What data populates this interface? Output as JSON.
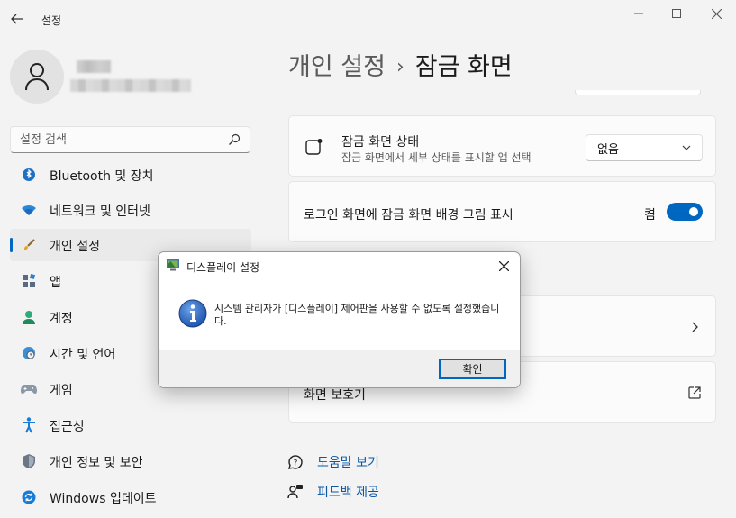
{
  "window": {
    "title": "설정",
    "back_icon": "arrow-left-icon",
    "minimize_icon": "minimize-icon",
    "maximize_icon": "maximize-icon",
    "close_icon": "close-icon"
  },
  "search": {
    "placeholder": "설정 검색",
    "icon": "search-icon"
  },
  "sidebar": {
    "items": [
      {
        "label": "Bluetooth 및 장치",
        "icon": "bluetooth-icon",
        "active": false
      },
      {
        "label": "네트워크 및 인터넷",
        "icon": "wifi-icon",
        "active": false
      },
      {
        "label": "개인 설정",
        "icon": "brush-icon",
        "active": true
      },
      {
        "label": "앱",
        "icon": "apps-icon",
        "active": false
      },
      {
        "label": "계정",
        "icon": "account-icon",
        "active": false
      },
      {
        "label": "시간 및 언어",
        "icon": "globe-clock-icon",
        "active": false
      },
      {
        "label": "게임",
        "icon": "gamepad-icon",
        "active": false
      },
      {
        "label": "접근성",
        "icon": "accessibility-icon",
        "active": false
      },
      {
        "label": "개인 정보 및 보안",
        "icon": "shield-icon",
        "active": false
      },
      {
        "label": "Windows 업데이트",
        "icon": "update-icon",
        "active": false
      }
    ]
  },
  "header": {
    "parent": "개인 설정",
    "separator": "›",
    "current": "잠금 화면"
  },
  "main": {
    "lock_status": {
      "title": "잠금 화면 상태",
      "subtitle": "잠금 화면에서 세부 상태를 표시할 앱 선택",
      "selected": "없음"
    },
    "signin_background": {
      "title": "로그인 화면에 잠금 화면 배경 그림 표시",
      "state_label": "켬",
      "on": true
    },
    "screensaver": {
      "title": "화면 보호기"
    },
    "links": [
      {
        "label": "도움말 보기",
        "icon": "help-icon"
      },
      {
        "label": "피드백 제공",
        "icon": "feedback-icon"
      }
    ]
  },
  "dialog": {
    "title": "디스플레이 설정",
    "message": "시스템 관리자가 [디스플레이] 제어판을 사용할 수 없도록 설정했습니다.",
    "ok_label": "확인",
    "icon": "info-icon"
  },
  "colors": {
    "accent": "#0067c0",
    "background": "#f3f3f3",
    "card": "#fbfbfb",
    "link": "#0a57a8"
  }
}
